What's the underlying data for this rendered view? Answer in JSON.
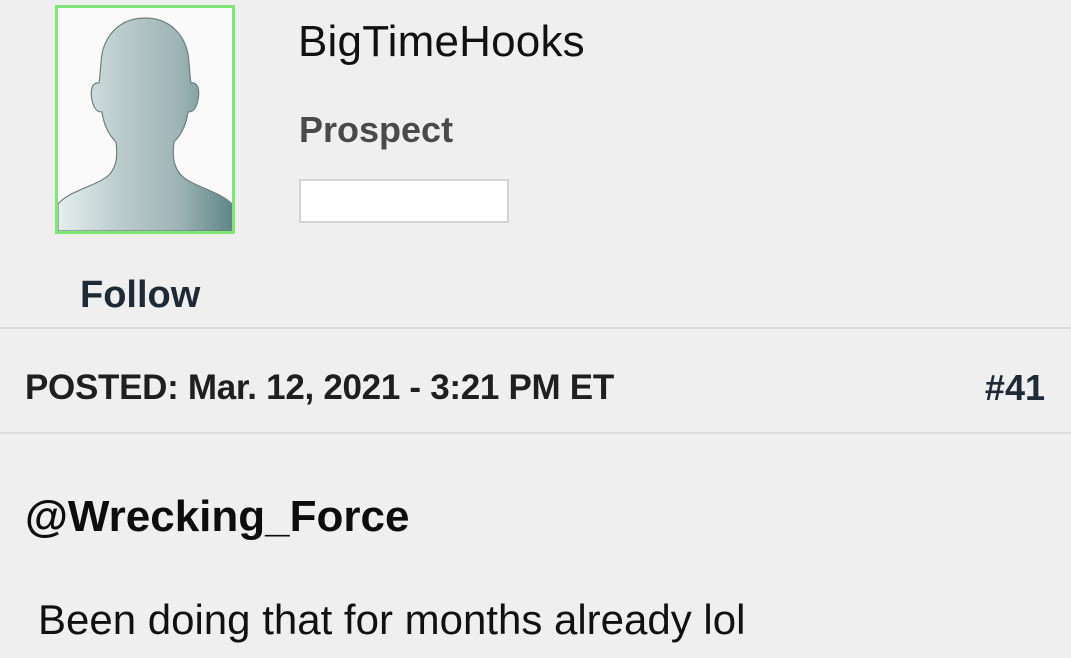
{
  "user": {
    "name": "BigTimeHooks",
    "rank": "Prospect",
    "follow_label": "Follow",
    "avatar_icon": "default-silhouette-icon",
    "avatar_border_color": "#82e57a"
  },
  "post": {
    "posted_label": "POSTED: Mar. 12, 2021 - 3:21 PM ET",
    "number": "#41",
    "mention": "@Wrecking_Force",
    "text": "Been doing that for months already lol"
  }
}
